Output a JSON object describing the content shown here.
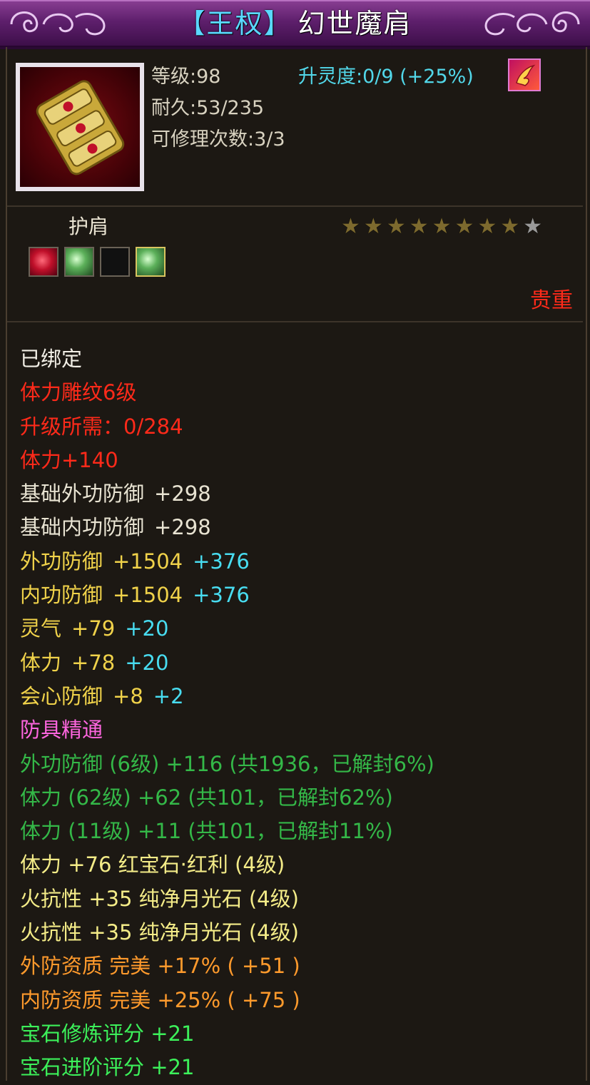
{
  "title": {
    "bracket_open": "【",
    "tag": "王权",
    "bracket_close": "】",
    "item_name": "幻世魔肩"
  },
  "item": {
    "level": "等级:98",
    "durability": "耐久:53/235",
    "repair_count": "可修理次数:3/3",
    "spirit_upgrade": "升灵度:0/9 (+25%)",
    "slot_type": "护肩",
    "quality": "贵重",
    "stars_filled": 8,
    "stars_total": 9,
    "icon": "shoulder-scroll-icon",
    "spirit_icon": "spirit-flame-icon"
  },
  "gems": [
    {
      "name": "red-gem-icon",
      "active": false
    },
    {
      "name": "green-gem-icon",
      "active": false
    },
    {
      "name": "empty-slot",
      "active": false
    },
    {
      "name": "green-gem-icon",
      "active": true
    }
  ],
  "attributes": {
    "bound": "已绑定",
    "engrave": "体力雕纹6级",
    "upgrade_need": "升级所需：0/284",
    "stamina_engrave": "体力+140",
    "base_out_def_label": "基础外功防御",
    "base_out_def_value": "+298",
    "base_in_def_label": "基础内功防御",
    "base_in_def_value": "+298",
    "out_def_label": "外功防御",
    "out_def_value": "+1504",
    "out_def_bonus": "+376",
    "in_def_label": "内功防御",
    "in_def_value": "+1504",
    "in_def_bonus": "+376",
    "spirit_label": "灵气",
    "spirit_value": "+79",
    "spirit_bonus": "+20",
    "stamina_label": "体力",
    "stamina_value": "+78",
    "stamina_bonus": "+20",
    "crit_def_label": "会心防御",
    "crit_def_value": "+8",
    "crit_def_bonus": "+2",
    "mastery_title": "防具精通",
    "mastery_1": "外功防御 (6级) +116 (共1936，已解封6%)",
    "mastery_2": "体力 (62级) +62 (共101，已解封62%)",
    "mastery_3": "体力 (11级) +11 (共101，已解封11%)",
    "gem_1": "体力 +76  红宝石·红利 (4级)",
    "gem_2": "火抗性 +35  纯净月光石 (4级)",
    "gem_3": "火抗性 +35  纯净月光石 (4级)",
    "quality_out": "外防资质    完美  +17% ( +51 )",
    "quality_in": "内防资质    完美  +25% ( +75 )",
    "gem_refine": "宝石修炼评分  +21",
    "gem_advance": "宝石进阶评分  +21"
  }
}
